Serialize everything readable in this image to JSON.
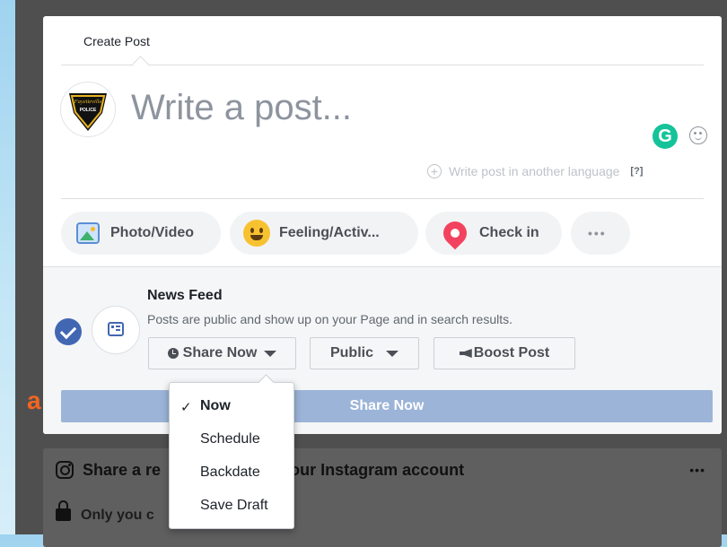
{
  "composer": {
    "tab_title": "Create Post",
    "write_placeholder": "Write a post...",
    "grammarly_letter": "G",
    "lang_plus": "+",
    "lang_link": "Write post in another language",
    "lang_help": "[?]",
    "avatar_badge_lines": [
      "Fayetteville",
      "POLICE"
    ]
  },
  "actions": {
    "photo_video": "Photo/Video",
    "feeling": "Feeling/Activ...",
    "check_in": "Check in",
    "more": "•••"
  },
  "audience": {
    "title": "News Feed",
    "description": "Posts are public and show up on your Page and in search results.",
    "schedule_button": "Share Now",
    "privacy_button": "Public",
    "boost_button": "Boost Post",
    "share_bar": "Share Now"
  },
  "dropdown": {
    "items": [
      {
        "label": "Now",
        "checked": "✓"
      },
      {
        "label": "Schedule"
      },
      {
        "label": "Backdate"
      },
      {
        "label": "Save Draft"
      }
    ]
  },
  "instagram": {
    "title_start": "Share a re",
    "title_end": "om your Instagram account",
    "more": "•••",
    "privacy_start": "Only you c"
  },
  "annotation": {
    "marker": "a"
  },
  "colors": {
    "accent": "#4267b2",
    "share_bar": "#9cb4d8",
    "grammarly": "#15c39a",
    "marker": "#f26522",
    "backdrop": "#4f4f4f"
  }
}
